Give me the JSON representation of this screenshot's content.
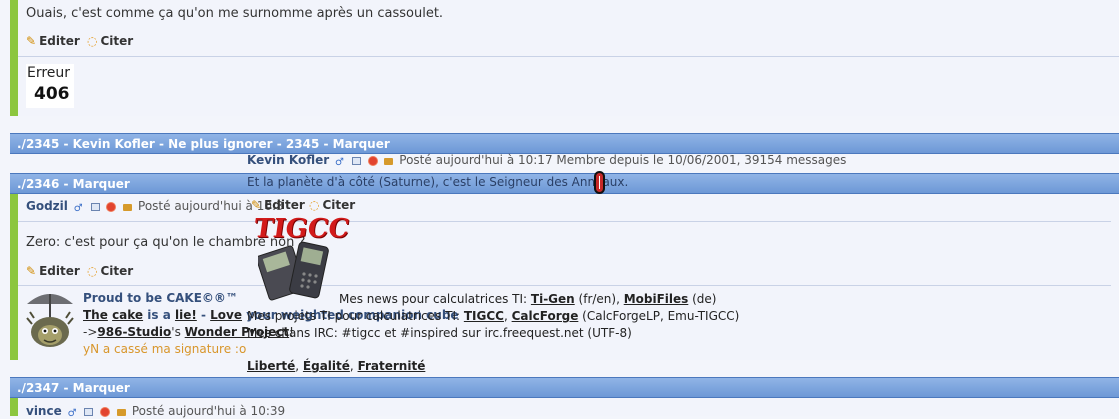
{
  "post_top": {
    "text": "Ouais, c'est comme ça qu'on me surnomme après un cassoulet.",
    "edit": "Editer",
    "quote": "Citer",
    "error_label": "Erreur",
    "error_code": "406"
  },
  "post_2345": {
    "header": "./2345 - Kevin Kofler - Ne plus ignorer - 2345 - Marquer",
    "author": "Kevin Kofler",
    "meta": "Posté aujourd'hui à 10:17 Membre depuis le 10/06/2001, 39154 messages",
    "text": "Et la planète d'à côté (Saturne), c'est le Seigneur des Anneaux.",
    "edit": "Editer",
    "quote": "Citer",
    "logo": "TIGCC",
    "sig_line1_prefix": "Mes news pour calculatrices TI: ",
    "sig_tigen": "Ti-Gen",
    "sig_tigen_lang": " (fr/en), ",
    "sig_mobifiles": "MobiFiles",
    "sig_mobifiles_lang": " (de)",
    "sig_line2_prefix": "Mes projets TI pour calculatrices TI: ",
    "sig_tigcc": "TIGCC",
    "sig_comma": ", ",
    "sig_calcforge": "CalcForge",
    "sig_line2_suffix": " (CalcForgeLP, Emu-TIGCC)",
    "sig_line3": "Mes chans IRC: #tigcc et #inspired sur irc.freequest.net (UTF-8)",
    "liberte": "Liberté",
    "egalite": "Égalité",
    "fraternite": "Fraternité"
  },
  "post_2346": {
    "header": "./2346 - Marquer",
    "author": "Godzil",
    "meta": "Posté aujourd'hui à 10:3",
    "text": "Zero: c'est pour ça qu'on le chambre non ?",
    "edit": "Editer",
    "quote": "Citer",
    "sig_title": "Proud to be CAKE©®™",
    "sig_the": "The",
    "sig_cake": "cake",
    "sig_is_a": " is a ",
    "sig_lie": "lie!",
    "sig_dash": " - ",
    "sig_love": "Love",
    "sig_rest": " your weighted companion cube",
    "sig_arrow": "->",
    "sig_studio": "986-Studio",
    "sig_s": "'s ",
    "sig_wonder": "Wonder Project",
    "sig_bang": "!",
    "sig_broken": "yN a cassé ma signature :o"
  },
  "post_2347": {
    "header": "./2347 - Marquer",
    "author": "vince",
    "meta": "Posté aujourd'hui à 10:39"
  }
}
